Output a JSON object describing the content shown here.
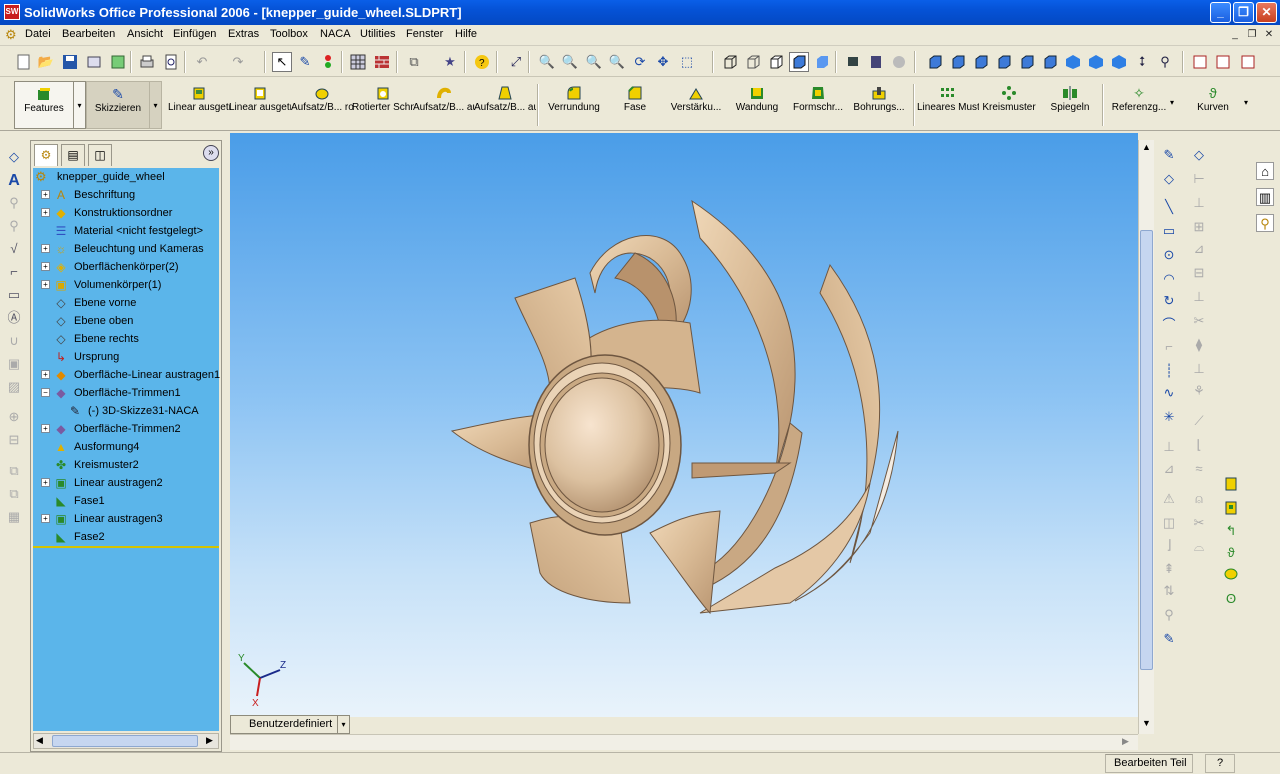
{
  "window": {
    "title": "SolidWorks Office Professional 2006 - [knepper_guide_wheel.SLDPRT]",
    "app_icon_text": "SW",
    "minimize": "_",
    "maximize": "❐",
    "close": "✕"
  },
  "menu": {
    "items": [
      "Datei",
      "Bearbeiten",
      "Ansicht",
      "Einfügen",
      "Extras",
      "Toolbox",
      "NACA",
      "Utilities",
      "Fenster",
      "Hilfe"
    ],
    "mdi_controls": [
      "_",
      "❐",
      "✕"
    ]
  },
  "command_manager": {
    "tabs": [
      "Features",
      "Skizzieren"
    ],
    "commands": [
      {
        "label": "Linear ausgetrag...",
        "icon": "extruded-boss-icon"
      },
      {
        "label": "Linear ausgetrag...",
        "icon": "extruded-cut-icon"
      },
      {
        "label": "Aufsatz/B... rotiert",
        "icon": "revolved-boss-icon"
      },
      {
        "label": "Rotierter Schnitt",
        "icon": "revolved-cut-icon"
      },
      {
        "label": "Aufsatz/B... ausgetragen",
        "icon": "swept-boss-icon"
      },
      {
        "label": "Aufsatz/B... ausgeformt",
        "icon": "lofted-boss-icon"
      },
      {
        "label": "Verrundung",
        "icon": "fillet-icon"
      },
      {
        "label": "Fase",
        "icon": "chamfer-icon"
      },
      {
        "label": "Verstärku...",
        "icon": "rib-icon"
      },
      {
        "label": "Wandung",
        "icon": "shell-icon"
      },
      {
        "label": "Formschr...",
        "icon": "draft-icon"
      },
      {
        "label": "Bohrungs...",
        "icon": "hole-wizard-icon"
      },
      {
        "label": "Lineares Muster",
        "icon": "linear-pattern-icon"
      },
      {
        "label": "Kreismuster",
        "icon": "circular-pattern-icon"
      },
      {
        "label": "Spiegeln",
        "icon": "mirror-icon"
      },
      {
        "label": "Referenzg...",
        "icon": "reference-geometry-icon"
      },
      {
        "label": "Kurven",
        "icon": "curves-icon"
      }
    ]
  },
  "feature_tree": {
    "root": "knepper_guide_wheel",
    "nodes": [
      {
        "label": "Beschriftung",
        "expand": "+",
        "icon": "annotations-icon"
      },
      {
        "label": "Konstruktionsordner",
        "expand": "+",
        "icon": "design-binder-icon"
      },
      {
        "label": "Material <nicht festgelegt>",
        "expand": "",
        "icon": "material-icon"
      },
      {
        "label": "Beleuchtung und Kameras",
        "expand": "+",
        "icon": "lighting-icon"
      },
      {
        "label": "Oberflächenkörper(2)",
        "expand": "+",
        "icon": "surface-bodies-icon"
      },
      {
        "label": "Volumenkörper(1)",
        "expand": "+",
        "icon": "solid-bodies-icon"
      },
      {
        "label": "Ebene vorne",
        "expand": "",
        "icon": "plane-icon"
      },
      {
        "label": "Ebene oben",
        "expand": "",
        "icon": "plane-icon"
      },
      {
        "label": "Ebene rechts",
        "expand": "",
        "icon": "plane-icon"
      },
      {
        "label": "Ursprung",
        "expand": "",
        "icon": "origin-icon"
      },
      {
        "label": "Oberfläche-Linear austragen1",
        "expand": "+",
        "icon": "surface-extrude-icon"
      },
      {
        "label": "Oberfläche-Trimmen1",
        "expand": "−",
        "icon": "surface-trim-icon"
      },
      {
        "label": "(-) 3D-Skizze31-NACA",
        "expand": "",
        "icon": "3d-sketch-icon",
        "child": true
      },
      {
        "label": "Oberfläche-Trimmen2",
        "expand": "+",
        "icon": "surface-trim-icon"
      },
      {
        "label": "Ausformung4",
        "expand": "",
        "icon": "loft-icon"
      },
      {
        "label": "Kreismuster2",
        "expand": "",
        "icon": "circular-pattern-icon"
      },
      {
        "label": "Linear austragen2",
        "expand": "+",
        "icon": "extrude-icon"
      },
      {
        "label": "Fase1",
        "expand": "",
        "icon": "chamfer-icon"
      },
      {
        "label": "Linear austragen3",
        "expand": "+",
        "icon": "extrude-icon"
      },
      {
        "label": "Fase2",
        "expand": "",
        "icon": "chamfer-icon"
      }
    ]
  },
  "viewport": {
    "view_orientation": "Benutzerdefiniert",
    "triad": {
      "x": "X",
      "y": "Y",
      "z": "Z"
    }
  },
  "status_bar": {
    "mode": "Bearbeiten Teil",
    "help": "?"
  },
  "colors": {
    "tree_bg": "#5bb5ea",
    "title_bar": "#0552d6",
    "part_color": "#d8b994"
  }
}
